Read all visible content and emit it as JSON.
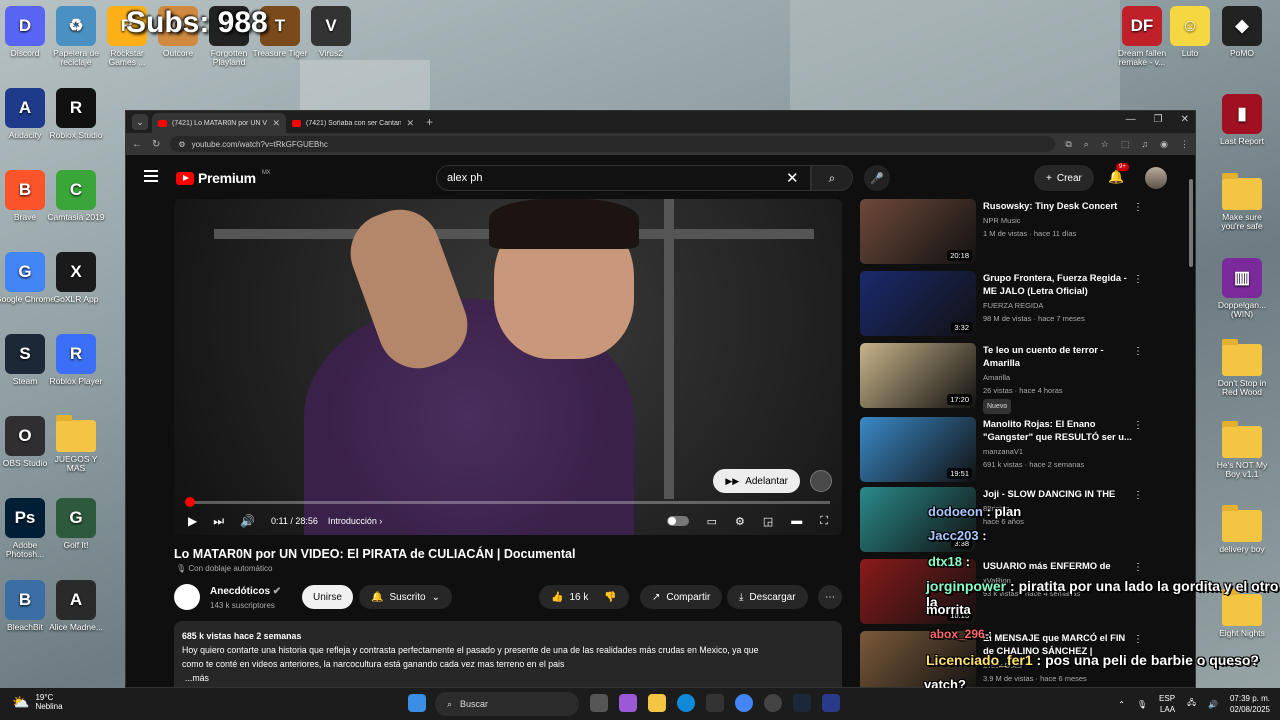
{
  "overlay": {
    "subs": "Subs: 988"
  },
  "desktop": {
    "left_icons": [
      {
        "label": "Discord",
        "color": "#5865f2",
        "glyph": "D"
      },
      {
        "label": "Papelera de reciclaje",
        "color": "#4a90c2",
        "glyph": "♻"
      },
      {
        "label": "Rockstar Games ...",
        "color": "#fcaf17",
        "glyph": "R"
      },
      {
        "label": "Outcore",
        "color": "#d08a40",
        "glyph": "O"
      },
      {
        "label": "Forgotten Playland",
        "color": "#222222",
        "glyph": "F"
      },
      {
        "label": "Treasure Tiger",
        "color": "#7a4a1a",
        "glyph": "T"
      },
      {
        "label": "Virus2",
        "color": "#333333",
        "glyph": "V"
      },
      {
        "label": "Audacity",
        "color": "#1e3a8a",
        "glyph": "A"
      },
      {
        "label": "Roblox Studio",
        "color": "#111111",
        "glyph": "R"
      },
      {
        "label": "Brave",
        "color": "#fb542b",
        "glyph": "B"
      },
      {
        "label": "Camtasia 2019",
        "color": "#3aa63a",
        "glyph": "C"
      },
      {
        "label": "Google Chrome",
        "color": "#4285f4",
        "glyph": "G"
      },
      {
        "label": "GoXLR App",
        "color": "#1a1a1a",
        "glyph": "X"
      },
      {
        "label": "Steam",
        "color": "#1b2838",
        "glyph": "S"
      },
      {
        "label": "Roblox Player",
        "color": "#3b6ff5",
        "glyph": "R"
      },
      {
        "label": "OBS Studio",
        "color": "#302e31",
        "glyph": "O"
      },
      {
        "label": "JUEGOS Y MAS",
        "color": "folder",
        "glyph": ""
      },
      {
        "label": "Adobe Photosh...",
        "color": "#001e36",
        "glyph": "Ps"
      },
      {
        "label": "Golf It!",
        "color": "#2d5a3c",
        "glyph": "G"
      },
      {
        "label": "BleachBit",
        "color": "#3a6ea5",
        "glyph": "B"
      },
      {
        "label": "Alice Madne...",
        "color": "#2a2a2a",
        "glyph": "A"
      }
    ],
    "right_icons": [
      {
        "label": "Dream fallen remake - v...",
        "color": "#c0202a",
        "glyph": "DF"
      },
      {
        "label": "Luto",
        "color": "#f5d742",
        "glyph": "☺"
      },
      {
        "label": "PoMO",
        "color": "#222222",
        "glyph": "◆"
      },
      {
        "label": "Last Report",
        "color": "#a01020",
        "glyph": "▮"
      },
      {
        "label": "Make sure you're safe",
        "color": "folder",
        "glyph": ""
      },
      {
        "label": "Doppelgan... (WIN)",
        "color": "#7a2a9a",
        "glyph": "▥"
      },
      {
        "label": "Don't Stop in Red Wood",
        "color": "folder",
        "glyph": ""
      },
      {
        "label": "He's NOT My Boy v1.1",
        "color": "folder",
        "glyph": ""
      },
      {
        "label": "delivery boy",
        "color": "folder",
        "glyph": ""
      },
      {
        "label": "Eight Nights",
        "color": "folder",
        "glyph": ""
      }
    ]
  },
  "browser": {
    "tabs": [
      {
        "label": "(7421) Lo MATAR0N por UN VI",
        "active": true
      },
      {
        "label": "(7421) Soñaba con ser Cantante",
        "active": false
      }
    ],
    "url": "youtube.com/watch?v=tRkGFGUEBhc"
  },
  "youtube": {
    "logo": "Premium",
    "region": "MX",
    "search_value": "alex ph",
    "create_label": "Crear",
    "notif_badge": "9+",
    "player": {
      "progress": 0.0065,
      "time": "0:11 / 28:56",
      "chapter": "Introducción",
      "skip_label": "Adelantar"
    },
    "video": {
      "title": "Lo MATAR0N por UN VIDEO: El PIRATA de CULIACÁN | Documental",
      "dub": "Con doblaje automático",
      "channel": "Anecdóticos",
      "subs": "143 k suscriptores",
      "join": "Unirse",
      "subscribed": "Suscrito",
      "likes": "16 k",
      "share": "Compartir",
      "download": "Descargar",
      "meta": "685 k vistas  hace 2 semanas",
      "desc1": "Hoy quiero contarte una historia que refleja y contrasta perfectamente el pasado y presente de una de las realidades más crudas en Mexico, ya que",
      "desc2": "como te conté en videos anteriores, la narcocultura está ganando cada vez mas terreno en el pais",
      "more": "...más"
    },
    "related": [
      {
        "title": "Rusowsky: Tiny Desk Concert",
        "channel": "NPR Music",
        "views": "1 M de vistas · hace 11 días",
        "dur": "20:18",
        "thumb": "#6e4a3a",
        "new": ""
      },
      {
        "title": "Grupo Frontera, Fuerza Regida - ME JALO (Letra Oficial)",
        "channel": "FUERZA REGIDA",
        "views": "98 M de vistas · hace 7 meses",
        "dur": "3:32",
        "thumb": "#1a2a6e",
        "new": ""
      },
      {
        "title": "Te leo un cuento de terror - Amarilla",
        "channel": "Amarilla",
        "views": "26 vistas · hace 4 horas",
        "dur": "17:20",
        "thumb": "#c8b48a",
        "new": "Nuevo"
      },
      {
        "title": "Manolito Rojas: El Enano \"Gangster\" que RESULTÓ ser u...",
        "channel": "manzanaV1",
        "views": "691 k vistas · hace 2 semanas",
        "dur": "19:51",
        "thumb": "#3a8ac8",
        "new": ""
      },
      {
        "title": "Joji - SLOW DANCING IN THE",
        "channel": "88rising",
        "views": "hace 6 años",
        "dur": "3:38",
        "thumb": "#2a8a8a",
        "new": ""
      },
      {
        "title": "USUARIO más ENFERMO de",
        "channel": "xVaRion",
        "views": "93 k vistas · hace 4 semanas",
        "dur": "10:13",
        "thumb": "#8a1a1a",
        "new": ""
      },
      {
        "title": "El MENSAJE que MARCÓ el FIN de CHALINO SÁNCHEZ |",
        "channel": "Dreck Docs",
        "views": "3.9 M de vistas · hace 6 meses",
        "dur": "",
        "thumb": "#7a5a3a",
        "new": ""
      }
    ]
  },
  "chat": [
    {
      "user": "dodoeon",
      "msg": "plan"
    },
    {
      "user": "Jacc203",
      "msg": ""
    },
    {
      "user": "dtx18",
      "msg": ""
    },
    {
      "user": "jorginpower",
      "msg": "piratita por una lado la gordita y el otro la"
    },
    {
      "user": "",
      "msg": "morrita"
    },
    {
      "user": "abox_296",
      "msg": ""
    },
    {
      "user": "Licenciado_fer1",
      "msg": "pos una peli de barbie o queso?"
    },
    {
      "user": "",
      "msg": "vatch?"
    }
  ],
  "taskbar": {
    "temp": "19°C",
    "weather": "Neblina",
    "search": "Buscar",
    "lang": "ESP",
    "lang2": "LAA",
    "time": "07:39 p. m.",
    "date": "02/08/2025"
  }
}
